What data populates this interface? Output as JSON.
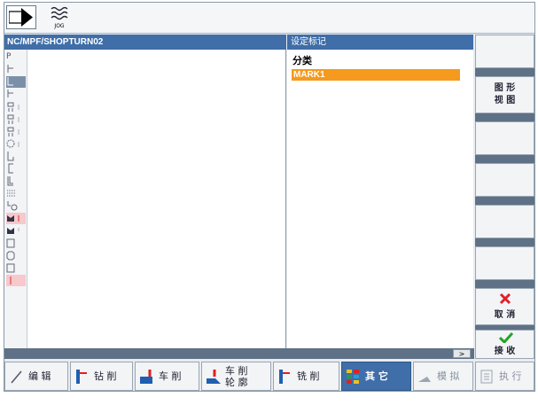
{
  "topbar": {
    "mode_icon": "arrow-right-icon",
    "jog_label": "JOG"
  },
  "program": {
    "path": "NC/MPF/SHOPTURN02",
    "first_label": "P"
  },
  "settings": {
    "title": "设定标记",
    "category_label": "分类",
    "selected_item": "MARK1"
  },
  "scroll_right_label": ">",
  "right_softkeys": {
    "graphic_view": "图 形\n视 图",
    "cancel": "取 消",
    "accept": "接 收"
  },
  "bottom_softkeys": [
    {
      "label": "编 辑",
      "icon": "edit-icon"
    },
    {
      "label": "钻 削",
      "icon": "drill-icon"
    },
    {
      "label": "车 削",
      "icon": "turn-icon"
    },
    {
      "label": "车 削\n轮 廓",
      "icon": "contour-turn-icon"
    },
    {
      "label": "铣 削",
      "icon": "mill-icon"
    },
    {
      "label": "其 它",
      "icon": "misc-icon"
    },
    {
      "label": "模 拟",
      "icon": "simulate-icon"
    },
    {
      "label": "执 行",
      "icon": "execute-icon"
    }
  ],
  "colors": {
    "header": "#3f6ea8",
    "selection": "#f59a1c",
    "bar": "#5f7186"
  }
}
